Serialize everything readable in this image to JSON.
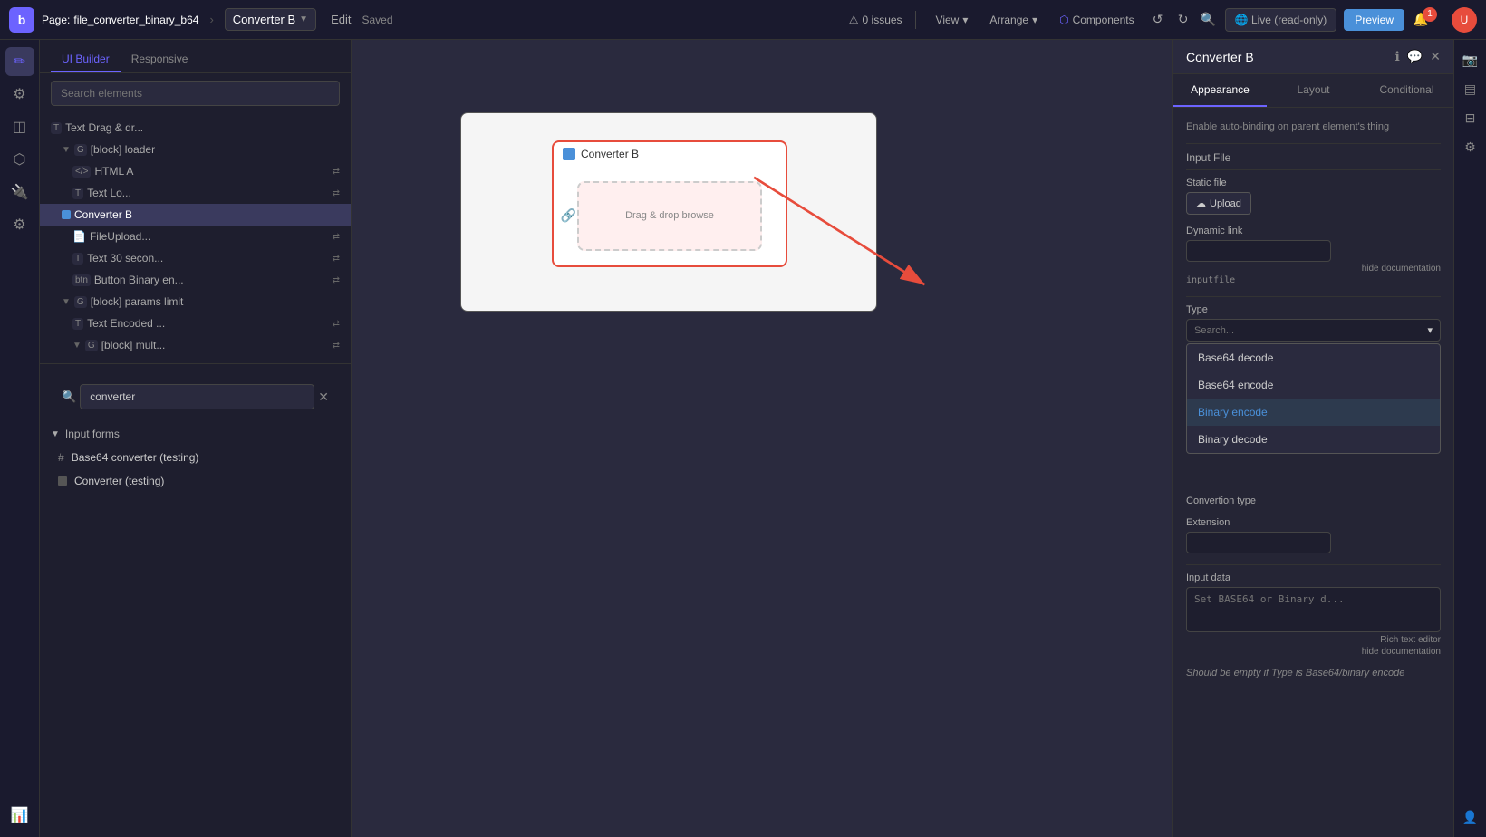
{
  "topbar": {
    "logo": "b",
    "page_label": "Page:",
    "page_name": "file_converter_binary_b64",
    "converter_label": "Converter B",
    "edit_label": "Edit",
    "saved_label": "Saved",
    "issues_count": "0 issues",
    "view_label": "View",
    "arrange_label": "Arrange",
    "components_label": "Components",
    "live_label": "Live (read-only)",
    "preview_label": "Preview",
    "notif_count": "1"
  },
  "left_panel": {
    "tabs": [
      "UI Builder",
      "Responsive"
    ],
    "search_placeholder": "Search elements",
    "tree": [
      {
        "indent": 0,
        "type": "T",
        "label": "Text Drag & dr...",
        "has_link": false
      },
      {
        "indent": 1,
        "type": "G",
        "label": "[block] loader",
        "has_link": false,
        "expanded": true
      },
      {
        "indent": 2,
        "type": "HTML",
        "label": "HTML A",
        "has_link": true
      },
      {
        "indent": 2,
        "type": "T",
        "label": "Text Lo...",
        "has_link": true
      },
      {
        "indent": 1,
        "type": "square",
        "label": "Converter B",
        "selected": true
      },
      {
        "indent": 2,
        "type": "file",
        "label": "FileUpload...",
        "has_link": true
      },
      {
        "indent": 2,
        "type": "T",
        "label": "Text 30 secon...",
        "has_link": true
      },
      {
        "indent": 2,
        "type": "btn",
        "label": "Button Binary en...",
        "has_link": true
      },
      {
        "indent": 1,
        "type": "G",
        "label": "[block] params limit",
        "expanded": true
      },
      {
        "indent": 2,
        "type": "T",
        "label": "Text Encoded ...",
        "has_link": true
      },
      {
        "indent": 2,
        "type": "G",
        "label": "[block] mult...",
        "has_link": true
      }
    ],
    "search_query": "converter",
    "search_results": {
      "section_label": "Input forms",
      "items": [
        {
          "type": "hash",
          "label": "Base64 converter (testing)"
        },
        {
          "type": "square",
          "label": "Converter (testing)"
        }
      ]
    }
  },
  "canvas": {
    "widget_title": "Converter B",
    "drag_drop_text": "Drag & drop browse"
  },
  "right_panel": {
    "title": "Converter B",
    "tabs": [
      "Appearance",
      "Layout",
      "Conditional"
    ],
    "active_tab": "Appearance",
    "autobinding_label": "Enable auto-binding on parent element's thing",
    "input_file_section": "Input File",
    "static_file_label": "Static file",
    "upload_btn": "Upload",
    "dynamic_link_label": "Dynamic link",
    "hide_doc_label": "hide documentation",
    "inputfile_code": "inputfile",
    "type_label": "Type",
    "type_search_placeholder": "Search...",
    "convertion_type_label": "Convertion type",
    "extension_label": "Extension",
    "dropdown_options": [
      "Base64 decode",
      "Base64 encode",
      "Binary encode",
      "Binary decode"
    ],
    "highlighted_option": "Binary encode",
    "input_data_label": "Input data",
    "input_data_placeholder": "Set BASE64 or Binary d...",
    "rich_text_editor_label": "Rich text editor",
    "hide_doc_label2": "hide documentation",
    "should_empty_label": "Should be empty if Type is Base64/binary encode"
  }
}
